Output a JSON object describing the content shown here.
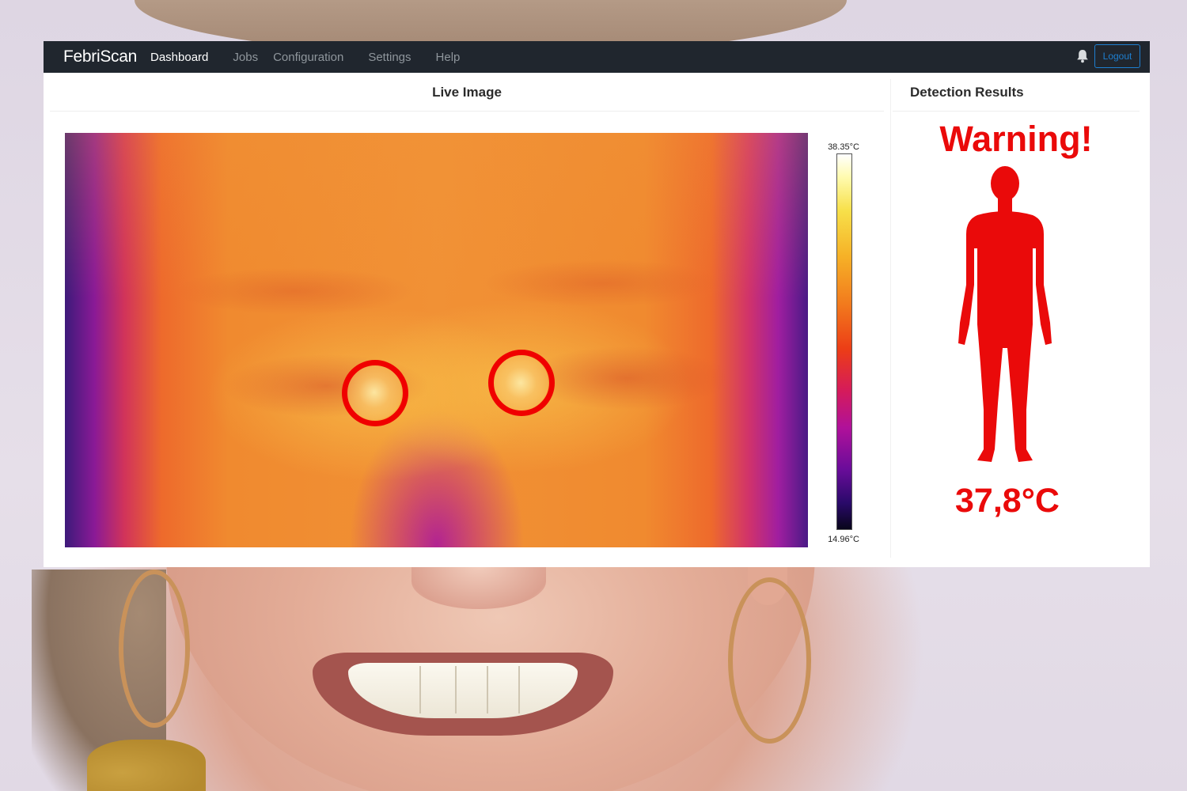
{
  "navbar": {
    "brand": "FebriScan",
    "links": [
      {
        "label": "Dashboard",
        "active": true
      },
      {
        "label": "Jobs",
        "active": false
      },
      {
        "label": "Configuration",
        "active": false
      },
      {
        "label": "Settings",
        "active": false
      },
      {
        "label": "Help",
        "active": false
      }
    ],
    "notification_icon": "bell-icon",
    "logout_label": "Logout"
  },
  "live_image": {
    "title": "Live Image",
    "scale_max": "38.35°C",
    "scale_min": "14.96°C"
  },
  "detection": {
    "title": "Detection Results",
    "status": "Warning!",
    "temperature": "37,8°C",
    "figure_icon": "human-body-icon"
  },
  "colors": {
    "navbar_bg": "#20262e",
    "warning_red": "#ea0a0a",
    "logout_blue": "#1e7fd0"
  }
}
